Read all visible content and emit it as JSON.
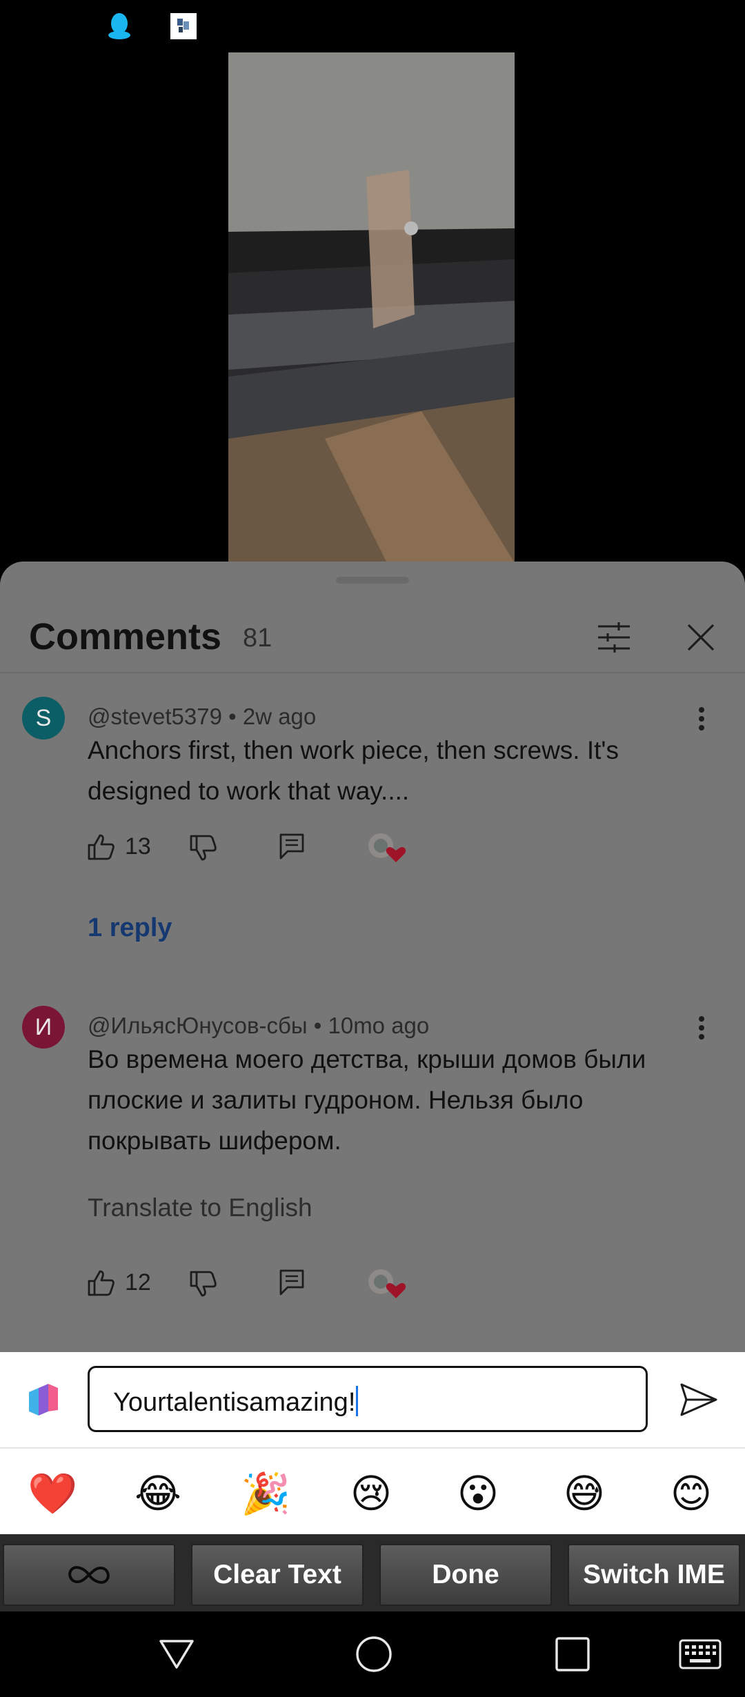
{
  "comments_panel": {
    "title": "Comments",
    "count": "81"
  },
  "comments": [
    {
      "avatar_letter": "S",
      "avatar_color": "#0b5e65",
      "author": "@stevet5379",
      "time": "2w ago",
      "meta": "@stevet5379 • 2w ago",
      "text": "Anchors first, then work piece, then screws. It's designed to work that way....",
      "likes": "13",
      "replies_label": "1 reply"
    },
    {
      "avatar_letter": "И",
      "avatar_color": "#7b1535",
      "author": "@ИльясЮнусов-сбы",
      "time": "10mo ago",
      "meta": "@ИльясЮнусов-сбы • 10mo ago",
      "text": "Во времена моего детства, крыши домов были плоские и залиты гудроном. Нельзя было покрывать шифером.",
      "translate_label": "Translate to English",
      "likes": "12"
    }
  ],
  "compose": {
    "value": "Yourtalentisamazing!"
  },
  "emoji_bar": [
    "❤️",
    "😂",
    "🎉",
    "😢",
    "😮",
    "😅",
    "😊"
  ],
  "keyboard_bar": {
    "infinity_label": "∞",
    "clear_label": "Clear Text",
    "done_label": "Done",
    "switch_label": "Switch IME"
  },
  "icons": {
    "status": [
      "qq-icon",
      "app-notification-icon"
    ],
    "nav": [
      "back-icon",
      "home-icon",
      "recents-icon",
      "keyboard-icon"
    ]
  }
}
